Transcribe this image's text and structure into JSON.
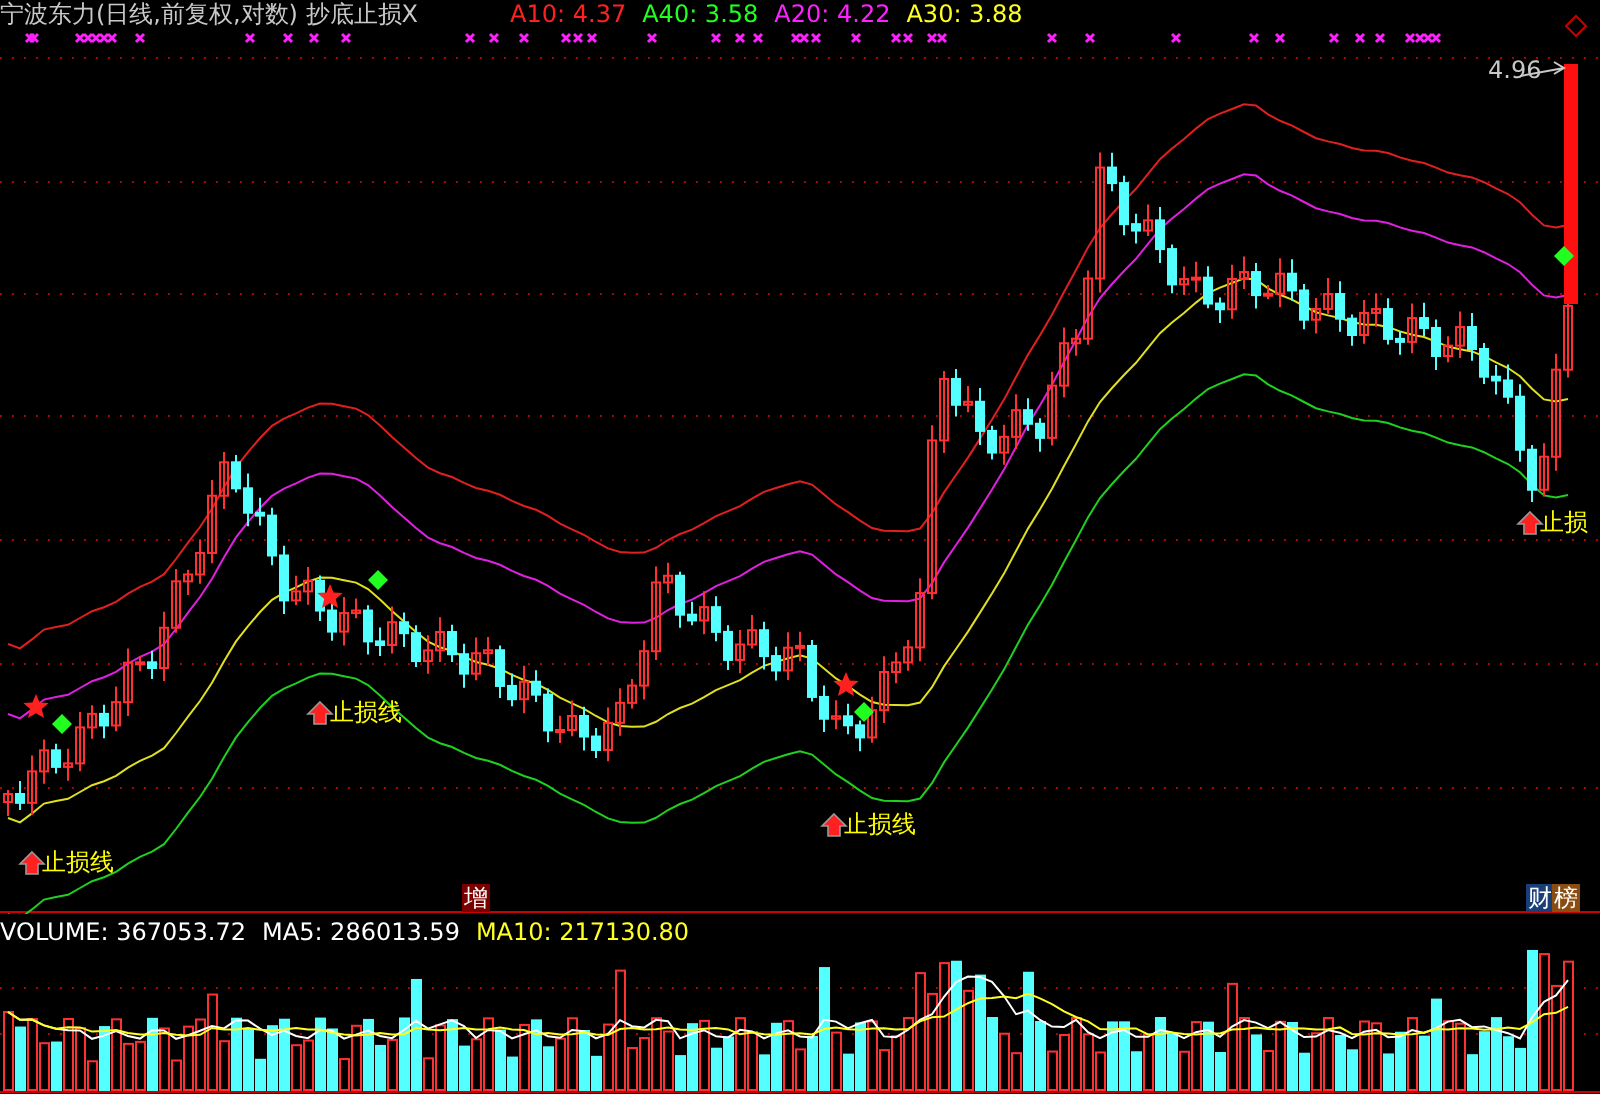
{
  "title": "宁波东力(日线,前复权,对数) 抄底止损X",
  "indicators": [
    {
      "text": "A10: 4.37",
      "color": "#ff2020"
    },
    {
      "text": "A40: 3.58",
      "color": "#20ff20"
    },
    {
      "text": "A20: 4.22",
      "color": "#ff20ff"
    },
    {
      "text": "A30: 3.88",
      "color": "#ffff20"
    }
  ],
  "price_label": "4.96",
  "signals": [
    {
      "label": "止损线"
    },
    {
      "label": "止损线"
    },
    {
      "label": "止损线"
    },
    {
      "label": "止损"
    }
  ],
  "badges": [
    {
      "text": "增",
      "kind": "boost"
    },
    {
      "text": "财",
      "kind": "finance"
    },
    {
      "text": "榜",
      "kind": "rank"
    }
  ],
  "volume_stats": [
    {
      "text": "VOLUME: 367053.72",
      "color": "#ffffff"
    },
    {
      "text": "MA5: 286013.59",
      "color": "#ffffff"
    },
    {
      "text": "MA10: 217130.80",
      "color": "#ffff20"
    }
  ]
}
